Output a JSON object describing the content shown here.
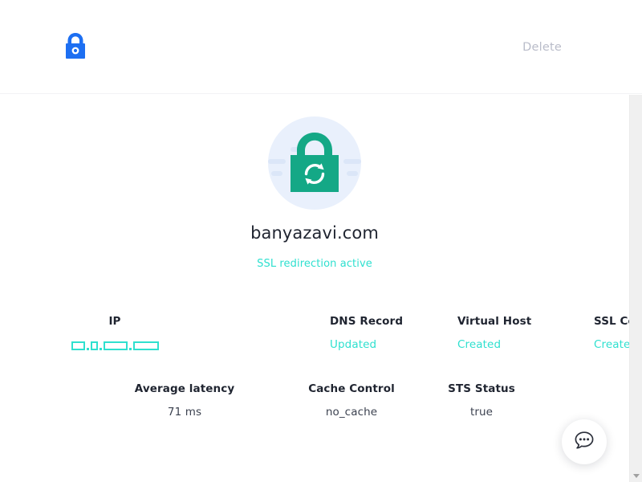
{
  "header": {
    "logo_icon": "padlock-icon",
    "logo_color": "#1d6ff2",
    "delete_label": "Delete"
  },
  "hero": {
    "badge_icon": "lock-refresh-icon",
    "badge_circle_color": "#e9f0fc",
    "badge_lock_color": "#14a886",
    "domain": "banyazavi.com",
    "ssl_status": "SSL redirection active"
  },
  "metrics": {
    "accent_color": "#2fe0cf",
    "row1": [
      {
        "label": "IP",
        "value": "",
        "masked": true,
        "type": "accent"
      },
      {
        "label": "DNS Record",
        "value": "Updated",
        "type": "accent"
      },
      {
        "label": "Virtual Host",
        "value": "Created",
        "type": "accent"
      },
      {
        "label": "SSL Certificate",
        "value": "Created",
        "type": "accent"
      }
    ],
    "row2": [
      {
        "label": "Average latency",
        "value": "71 ms",
        "type": "neutral"
      },
      {
        "label": "Cache Control",
        "value": "no_cache",
        "type": "neutral"
      },
      {
        "label": "STS Status",
        "value": "true",
        "type": "neutral"
      }
    ]
  },
  "chat_widget": {
    "icon": "chat-bubble-dots-icon"
  },
  "scrollbar": {
    "down_arrow_icon": "chevron-down-icon"
  }
}
